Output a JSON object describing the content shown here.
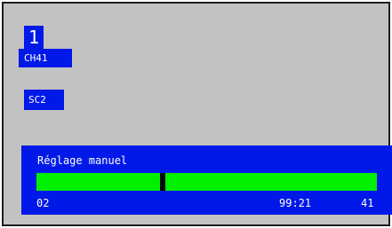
{
  "channel": {
    "number": "1",
    "name": "CH41"
  },
  "source": {
    "name": "SC2"
  },
  "tuning_panel": {
    "title": "Réglage manuel",
    "bar_level": 0.372,
    "start_value": "02",
    "frequency": "99:21",
    "channel_value": "41"
  },
  "colors": {
    "background": "#c2c2c2",
    "accent_blue": "#0019e8",
    "bar_green": "#00f000",
    "cursor_black": "#0a0a0a"
  }
}
